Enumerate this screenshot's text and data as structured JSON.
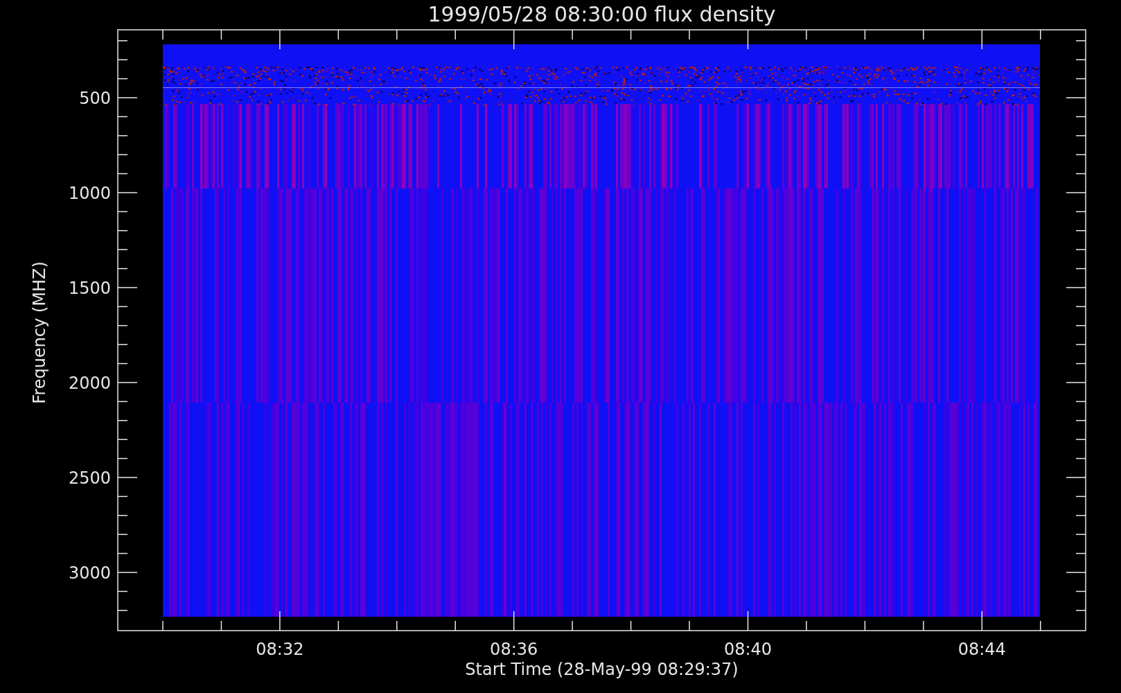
{
  "title": "1999/05/28 08:30:00 flux density",
  "y_axis": {
    "label": "Frequency (MHZ)",
    "ticks": [
      "500",
      "1000",
      "1500",
      "2000",
      "2500",
      "3000"
    ]
  },
  "x_axis": {
    "label": "Start Time (28-May-99 08:29:37)",
    "ticks": [
      "08:32",
      "08:36",
      "08:40",
      "08:44"
    ]
  }
}
